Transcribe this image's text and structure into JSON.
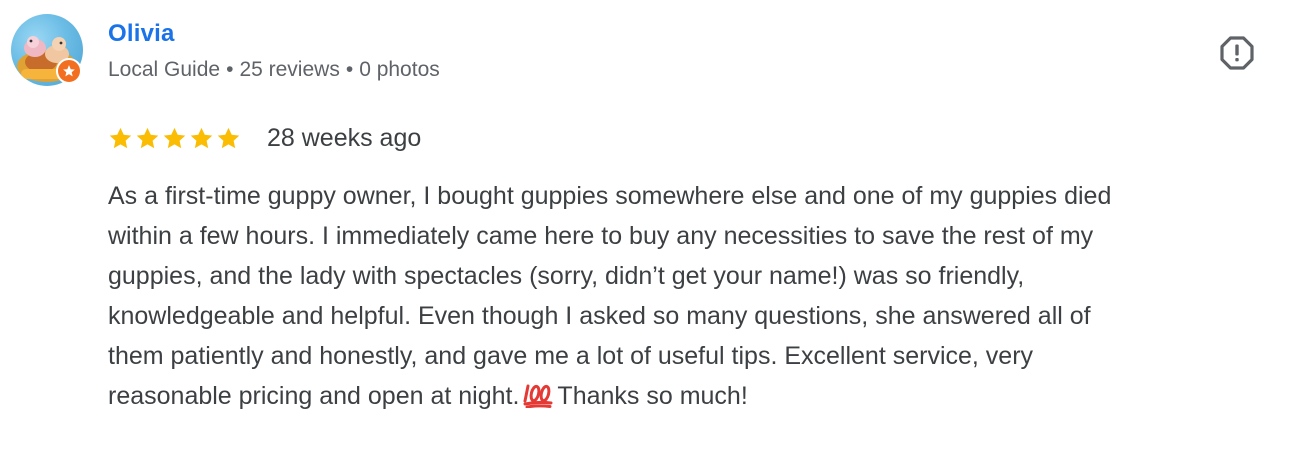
{
  "reviewer": {
    "name": "Olivia",
    "badge": "Local Guide",
    "reviews": "25 reviews",
    "photos": "0 photos",
    "separator": "•"
  },
  "review": {
    "rating": 5,
    "rating_max": 5,
    "time": "28 weeks ago",
    "lines": [
      "As a first-time guppy owner, I bought guppies somewhere else and one of my guppies died",
      "within a few hours. I immediately came here to buy any necessities to save the rest of my",
      "guppies, and the lady with spectacles (sorry, didn’t get your name!) was so friendly,",
      "knowledgeable and helpful. Even though I asked so many questions, she answered all of",
      "them patiently and honestly, and gave me a lot of useful tips. Excellent service, very",
      "reasonable pricing and open at night."
    ],
    "emoji_icon": "hundred-points-icon",
    "ending": "Thanks so much!"
  },
  "colors": {
    "name": "#1a73e8",
    "star": "#fbbc04",
    "badge": "#f26f21",
    "text": "#3c4043",
    "meta": "#5f6368",
    "emoji": "#e53935"
  },
  "icons": {
    "report": "report-octagon-icon",
    "guide_badge": "local-guide-star-icon"
  }
}
